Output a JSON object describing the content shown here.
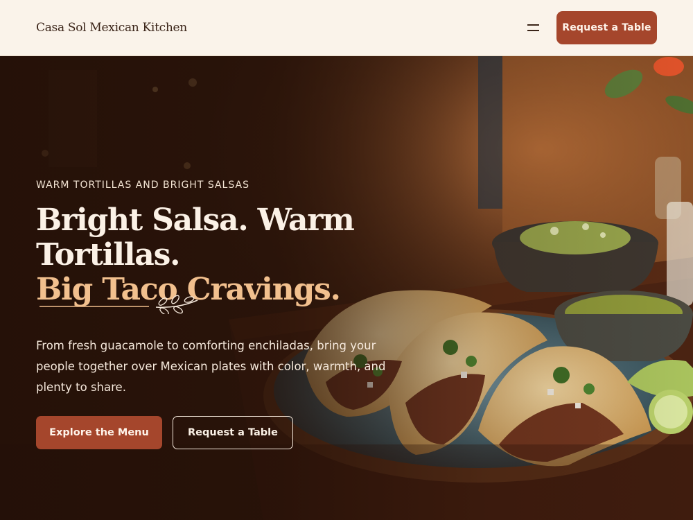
{
  "header": {
    "brand": "Casa Sol Mexican Kitchen",
    "menu_icon": "hamburger-menu-icon",
    "cta_label": "Request a Table"
  },
  "hero": {
    "eyebrow": "WARM TORTILLAS AND BRIGHT SALSAS",
    "headline_line1": "Bright Salsa. Warm Tortillas.",
    "headline_line2": "Big Taco Cravings.",
    "divider_icon": "leaf-sprig-icon",
    "lede": "From fresh guacamole to comforting enchiladas, bring your people together over Mexican plates with color, warmth, and plenty to share.",
    "primary_cta": "Explore the Menu",
    "secondary_cta": "Request a Table",
    "image_subject": "tacos-platter-photo"
  },
  "colors": {
    "header_bg": "#faf3ea",
    "brand_text": "#3a2418",
    "accent_terracotta": "#a5462c",
    "headline_accent": "#f2c08e",
    "hero_text": "#fbf1e6"
  }
}
